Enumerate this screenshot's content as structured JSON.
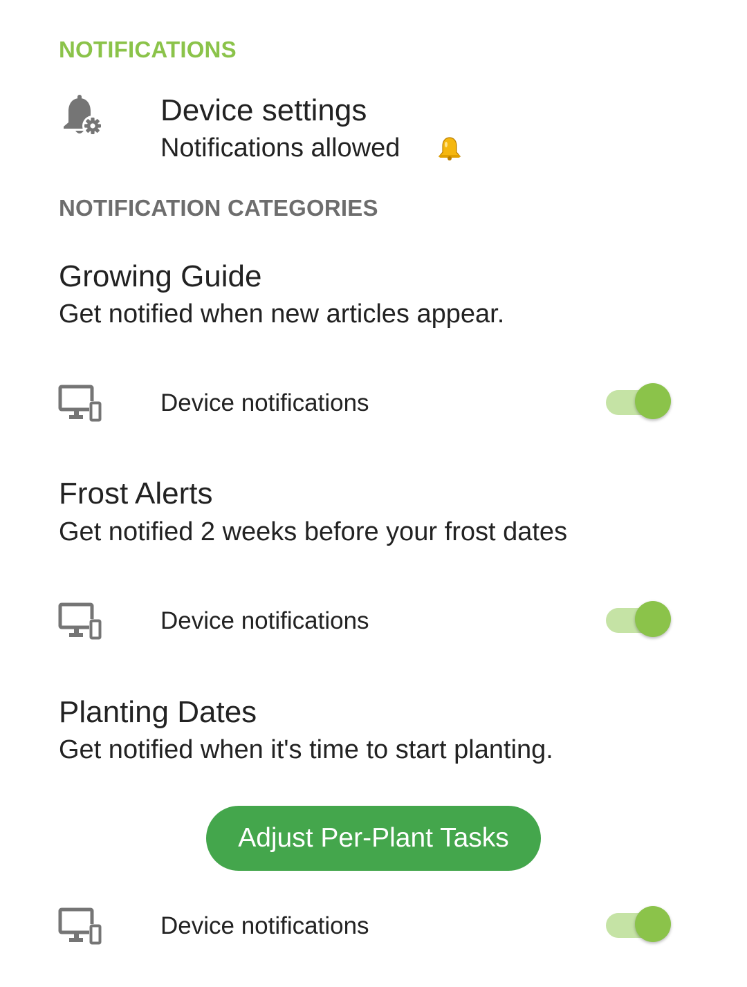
{
  "notifications": {
    "header": "NOTIFICATIONS",
    "device_settings": {
      "icon": "bell-settings-icon",
      "title": "Device settings",
      "subtitle": "Notifications allowed",
      "status_icon": "bell-emoji-icon"
    }
  },
  "categories": {
    "header": "NOTIFICATION CATEGORIES",
    "items": [
      {
        "title": "Growing Guide",
        "description": "Get notified when new articles appear.",
        "device_label": "Device notifications",
        "device_icon": "devices-icon",
        "enabled": true
      },
      {
        "title": "Frost Alerts",
        "description": "Get notified 2 weeks before your frost dates",
        "device_label": "Device notifications",
        "device_icon": "devices-icon",
        "enabled": true
      },
      {
        "title": "Planting Dates",
        "description": "Get notified when it's time to start planting.",
        "device_label": "Device notifications",
        "device_icon": "devices-icon",
        "enabled": true
      }
    ],
    "adjust_button_label": "Adjust Per-Plant Tasks"
  },
  "colors": {
    "accent_green": "#8bc34a",
    "button_green": "#44a64c",
    "track_green": "#c5e3a5",
    "header_gray": "#6d6d6d",
    "icon_gray": "#757575"
  }
}
